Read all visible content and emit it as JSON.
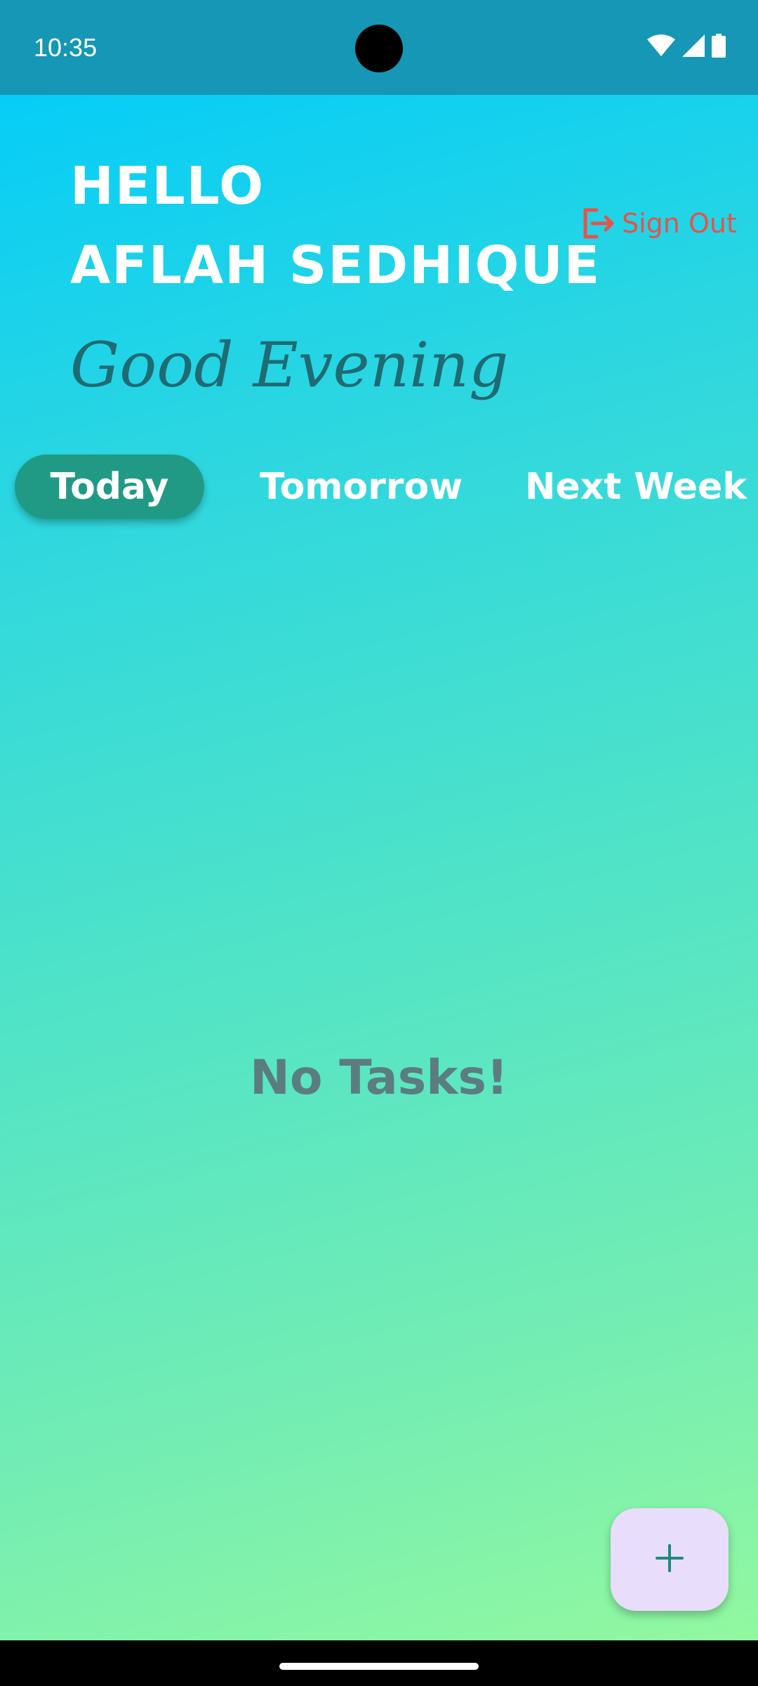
{
  "status_bar": {
    "time": "10:35",
    "icons": [
      "wifi-icon",
      "cellular-signal-icon",
      "battery-icon"
    ]
  },
  "header": {
    "hello": "HELLO",
    "user_name": "AFLAH SEDHIQUE",
    "time_greeting": "Good Evening",
    "sign_out": {
      "label": "Sign Out",
      "icon": "logout-icon",
      "color": "#e5534b"
    }
  },
  "tabs": [
    {
      "label": "Today",
      "active": true
    },
    {
      "label": "Tomorrow",
      "active": false
    },
    {
      "label": "Next Week",
      "active": false
    }
  ],
  "content": {
    "empty_message": "No Tasks!"
  },
  "fab": {
    "icon": "plus-icon"
  },
  "colors": {
    "status_bar": "#1597b5",
    "gradient_top": "#06cdf7",
    "gradient_bottom": "#92f8a0",
    "active_tab": "#219a85",
    "greeting_text": "#1f6b73",
    "empty_text": "#5b7d82",
    "fab_background": "#e9ddfc",
    "fab_icon": "#1f8a7a"
  }
}
